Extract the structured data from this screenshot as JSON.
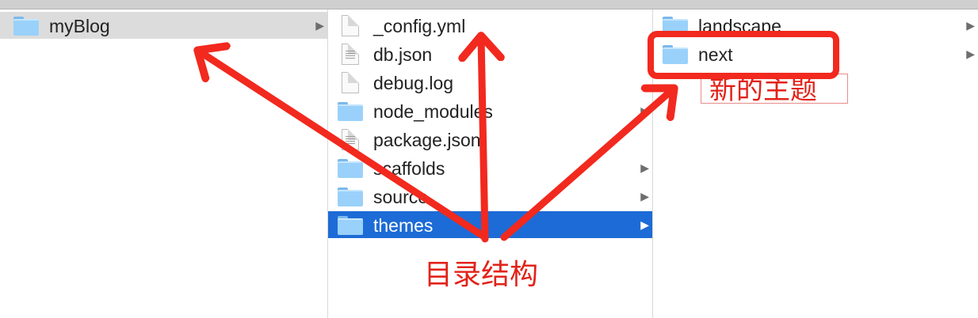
{
  "finder": {
    "column1": {
      "items": [
        {
          "label": "myBlog",
          "kind": "folder",
          "has_children": true,
          "selected": "inactive"
        }
      ]
    },
    "column2": {
      "items": [
        {
          "label": "_config.yml",
          "kind": "file-blank",
          "has_children": false
        },
        {
          "label": "db.json",
          "kind": "file-text",
          "has_children": false
        },
        {
          "label": "debug.log",
          "kind": "file-blank",
          "has_children": false
        },
        {
          "label": "node_modules",
          "kind": "folder",
          "has_children": true
        },
        {
          "label": "package.json",
          "kind": "file-text",
          "has_children": false
        },
        {
          "label": "scaffolds",
          "kind": "folder",
          "has_children": true
        },
        {
          "label": "source",
          "kind": "folder",
          "has_children": true
        },
        {
          "label": "themes",
          "kind": "folder",
          "has_children": true,
          "selected": "active"
        }
      ]
    },
    "column3": {
      "items": [
        {
          "label": "landscape",
          "kind": "folder",
          "has_children": true
        },
        {
          "label": "next",
          "kind": "folder",
          "has_children": true
        }
      ]
    },
    "chevron_glyph": "▶"
  },
  "annotations": {
    "new_theme": "新的主题",
    "directory_structure": "目录结构"
  },
  "colors": {
    "annotation_red": "#e2231a",
    "selection_blue": "#1d6bd6",
    "selection_gray": "#dcdcdc",
    "folder_blue": "#9ad1fa"
  }
}
